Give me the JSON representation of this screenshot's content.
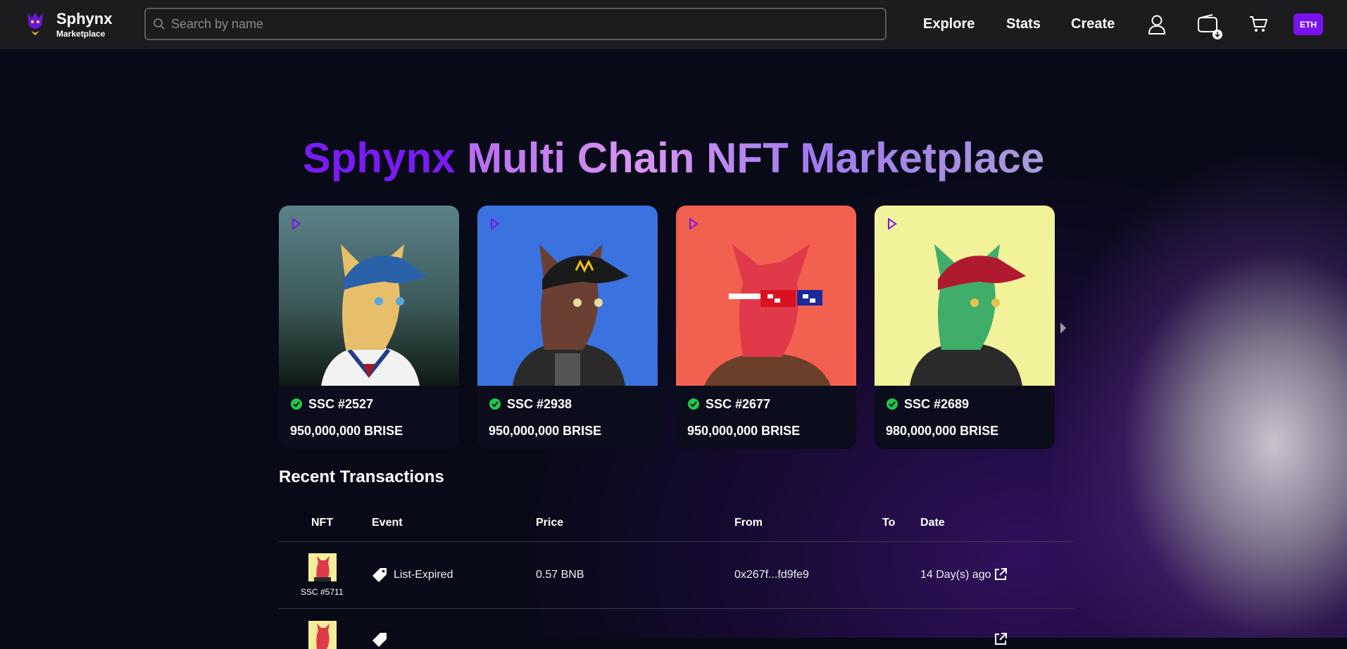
{
  "header": {
    "brand": "Sphynx",
    "brand_sub": "Marketplace",
    "search_placeholder": "Search by name",
    "nav": [
      "Explore",
      "Stats",
      "Create"
    ],
    "chain": "ETH",
    "icons": [
      "user-icon",
      "wallet-icon",
      "cart-icon"
    ]
  },
  "hero": {
    "title_part1": "Sphynx",
    "title_part2": "Multi Chain NFT Marketplace"
  },
  "cards": [
    {
      "name": "SSC #2527",
      "price": "950,000,000 BRISE",
      "bg": "#4a6b70"
    },
    {
      "name": "SSC #2938",
      "price": "950,000,000 BRISE",
      "bg": "#3a72e0"
    },
    {
      "name": "SSC #2677",
      "price": "950,000,000 BRISE",
      "bg": "#f2604f"
    },
    {
      "name": "SSC #2689",
      "price": "980,000,000 BRISE",
      "bg": "#f2f29a"
    }
  ],
  "transactions": {
    "title": "Recent Transactions",
    "columns": [
      "NFT",
      "Event",
      "Price",
      "From",
      "To",
      "Date"
    ],
    "rows": [
      {
        "nft": "SSC #5711",
        "event": "List-Expired",
        "price": "0.57 BNB",
        "from": "0x267f...fd9fe9",
        "to": "",
        "date": "14 Day(s) ago"
      }
    ]
  },
  "colors": {
    "accent": "#7a12f0",
    "header_bg": "#1c1c1f",
    "page_bg": "#080a17"
  }
}
